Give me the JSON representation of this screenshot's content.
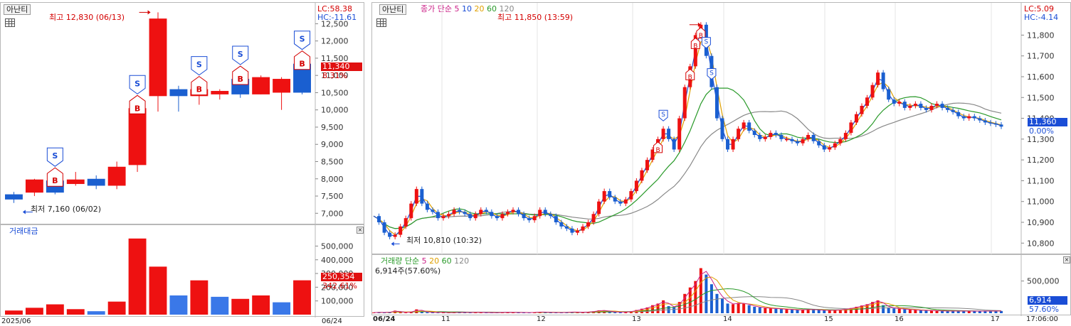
{
  "left": {
    "ticker": "아난티",
    "lc_label": "LC:58.38",
    "hc_label": "HC:-11.61",
    "high_annotation": "최고 12,830 (06/13)",
    "low_annotation": "최저 7,160 (06/02)",
    "price_ticks": [
      "12,500",
      "12,000",
      "11,500",
      "11,000",
      "10,500",
      "10,000",
      "9,500",
      "9,000",
      "8,500",
      "8,000",
      "7,500",
      "7,000"
    ],
    "current_price": "11,340",
    "current_change": "8.31%",
    "volume_title": "거래대금",
    "volume_ticks": [
      "500,000",
      "400,000",
      "300,000",
      "200,000",
      "100,000"
    ],
    "volume_current": "250,354",
    "volume_change": "342.61%",
    "date_left": "2025/06",
    "date_right": "06/24",
    "colors": {
      "up": "#ee1111",
      "down": "#1a5fd0"
    },
    "candles": [
      {
        "o": 7550,
        "h": 7620,
        "l": 7300,
        "c": 7400
      },
      {
        "o": 7600,
        "h": 8000,
        "l": 7500,
        "c": 7980
      },
      {
        "o": 7950,
        "h": 8050,
        "l": 7550,
        "c": 7600
      },
      {
        "o": 7850,
        "h": 8200,
        "l": 7800,
        "c": 7980
      },
      {
        "o": 8000,
        "h": 8100,
        "l": 7700,
        "c": 7800
      },
      {
        "o": 7800,
        "h": 8500,
        "l": 7700,
        "c": 8350
      },
      {
        "o": 8400,
        "h": 10150,
        "l": 8200,
        "c": 10050
      },
      {
        "o": 10400,
        "h": 12830,
        "l": 9950,
        "c": 12650
      },
      {
        "o": 10600,
        "h": 10700,
        "l": 9950,
        "c": 10400
      },
      {
        "o": 10400,
        "h": 10650,
        "l": 10150,
        "c": 10600
      },
      {
        "o": 10450,
        "h": 10600,
        "l": 10300,
        "c": 10550
      },
      {
        "o": 10900,
        "h": 10950,
        "l": 10350,
        "c": 10450
      },
      {
        "o": 10450,
        "h": 11000,
        "l": 10450,
        "c": 10950
      },
      {
        "o": 10500,
        "h": 10950,
        "l": 10000,
        "c": 10900
      },
      {
        "o": 11340,
        "h": 11340,
        "l": 10450,
        "c": 10500
      }
    ],
    "volumes": [
      {
        "v": 30000,
        "up": true
      },
      {
        "v": 50000,
        "up": true
      },
      {
        "v": 75000,
        "up": true
      },
      {
        "v": 40000,
        "up": true
      },
      {
        "v": 25000,
        "up": false
      },
      {
        "v": 95000,
        "up": true
      },
      {
        "v": 555000,
        "up": true
      },
      {
        "v": 350000,
        "up": true
      },
      {
        "v": 140000,
        "up": false
      },
      {
        "v": 250000,
        "up": true
      },
      {
        "v": 130000,
        "up": false
      },
      {
        "v": 115000,
        "up": true
      },
      {
        "v": 140000,
        "up": true
      },
      {
        "v": 90000,
        "up": false
      },
      {
        "v": 250354,
        "up": true
      }
    ],
    "signals": [
      {
        "candle": 2,
        "type": "S"
      },
      {
        "candle": 2,
        "type": "B"
      },
      {
        "candle": 6,
        "type": "S"
      },
      {
        "candle": 6,
        "type": "B"
      },
      {
        "candle": 9,
        "type": "S"
      },
      {
        "candle": 9,
        "type": "B"
      },
      {
        "candle": 11,
        "type": "S"
      },
      {
        "candle": 11,
        "type": "B"
      },
      {
        "candle": 14,
        "type": "S"
      },
      {
        "candle": 14,
        "type": "B"
      }
    ]
  },
  "right": {
    "ticker": "아난티",
    "ma_title": "종가 단순",
    "ma_periods": [
      "5",
      "10",
      "20",
      "60",
      "120"
    ],
    "ma_colors": [
      "#cc2288",
      "#1a4dd6",
      "#e0a000",
      "#2a9a2a",
      "#888888"
    ],
    "lc_label": "LC:5.09",
    "hc_label": "HC:-4.14",
    "high_annotation": "최고 11,850 (13:59)",
    "low_annotation": "최저 10,810 (10:32)",
    "price_ticks": [
      "11,800",
      "11,700",
      "11,600",
      "11,500",
      "11,400",
      "11,300",
      "11,200",
      "11,100",
      "11,000",
      "10,900",
      "10,800"
    ],
    "current_price": "11,360",
    "current_change": "0.00%",
    "volume_title": "거래량 단순",
    "volume_periods": [
      "5",
      "20",
      "60",
      "120"
    ],
    "volume_colors": [
      "#cc2288",
      "#e0a000",
      "#2a9a2a",
      "#888888"
    ],
    "volume_info": "6,914주(57.60%)",
    "volume_ticks": [
      "500,000"
    ],
    "volume_current": "6,914",
    "volume_change": "57.60%",
    "date_labels": [
      "06/24",
      "11",
      "12",
      "13",
      "14",
      "15",
      "16",
      "17"
    ],
    "time_label": "17:06:00",
    "close_path": [
      10930,
      10900,
      10850,
      10830,
      10840,
      10880,
      10920,
      10990,
      11060,
      10990,
      10960,
      10950,
      10920,
      10930,
      10940,
      10960,
      10950,
      10940,
      10920,
      10940,
      10960,
      10950,
      10930,
      10920,
      10940,
      10950,
      10960,
      10940,
      10920,
      10910,
      10930,
      10960,
      10940,
      10930,
      10900,
      10880,
      10870,
      10850,
      10860,
      10880,
      10900,
      10940,
      11000,
      11050,
      11020,
      11000,
      10990,
      11010,
      11050,
      11100,
      11150,
      11200,
      11250,
      11300,
      11350,
      11300,
      11250,
      11400,
      11550,
      11650,
      11800,
      11850,
      11700,
      11550,
      11400,
      11300,
      11250,
      11300,
      11350,
      11380,
      11340,
      11320,
      11300,
      11310,
      11330,
      11320,
      11300,
      11300,
      11290,
      11280,
      11300,
      11320,
      11290,
      11270,
      11250,
      11260,
      11280,
      11300,
      11330,
      11380,
      11420,
      11460,
      11500,
      11560,
      11620,
      11540,
      11490,
      11470,
      11480,
      11450,
      11460,
      11470,
      11450,
      11440,
      11460,
      11470,
      11450,
      11440,
      11430,
      11410,
      11400,
      11410,
      11400,
      11390,
      11380,
      11375,
      11370,
      11360
    ],
    "volume_path": [
      2000,
      3000,
      2000,
      4000,
      8000,
      3000,
      2000,
      5000,
      12000,
      6000,
      3000,
      2000,
      3000,
      2000,
      1500,
      2000,
      3000,
      2500,
      2000,
      3000,
      2000,
      2000,
      1500,
      2000,
      2500,
      3000,
      2000,
      2500,
      2000,
      2000,
      3000,
      4000,
      3000,
      2500,
      2000,
      2000,
      3000,
      4000,
      3000,
      3000,
      4000,
      6000,
      9000,
      8000,
      5000,
      4000,
      3000,
      4000,
      6000,
      10000,
      14000,
      18000,
      25000,
      30000,
      40000,
      22000,
      18000,
      35000,
      60000,
      80000,
      100000,
      140000,
      120000,
      90000,
      60000,
      45000,
      30000,
      28000,
      32000,
      30000,
      25000,
      20000,
      18000,
      16000,
      15000,
      14000,
      13000,
      12000,
      11000,
      10000,
      11000,
      12000,
      11000,
      10000,
      9000,
      9000,
      10000,
      11000,
      13000,
      16000,
      20000,
      24000,
      28000,
      35000,
      40000,
      25000,
      18000,
      15000,
      14000,
      12000,
      11000,
      10000,
      9000,
      8500,
      8000,
      7500,
      7000,
      7000,
      6900,
      6914,
      6800,
      6700,
      6600,
      6500,
      6914,
      6914,
      6914,
      6914
    ]
  }
}
